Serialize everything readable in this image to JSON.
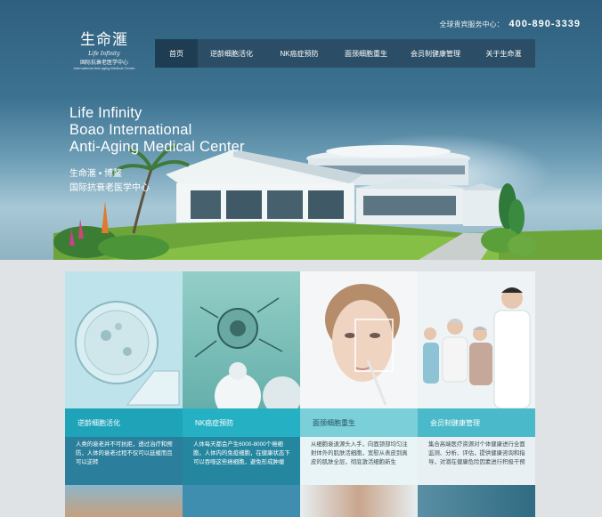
{
  "brand": {
    "logo_cn": "生命滙",
    "logo_en": "Life Infinity",
    "logo_sub": "国际抗衰老医学中心",
    "logo_sub_en": "International Anti-aging Medical Centre"
  },
  "hotline": {
    "label": "全球贵宾服务中心：",
    "number": "400-890-3339"
  },
  "nav": {
    "items": [
      {
        "label": "首页",
        "active": true
      },
      {
        "label": "逆龄细胞活化"
      },
      {
        "label": "NK癌症预防"
      },
      {
        "label": "面颈细胞重生"
      },
      {
        "label": "会员制健康管理"
      },
      {
        "label": "关于生命滙"
      }
    ]
  },
  "hero": {
    "line1": "Life Infinity",
    "line2": "Boao International",
    "line3": "Anti-Aging Medical Center",
    "cn1": "生命滙 • 博鳌",
    "cn2": "国际抗衰老医学中心"
  },
  "cards": [
    {
      "title": "逆龄细胞活化",
      "text": "人类的衰老并不可抗拒，透过治疗和预防，人体的衰老过程不仅可以延缓而且可以逆转",
      "icon": "cell-image"
    },
    {
      "title": "NK癌症预防",
      "text": "人体每天都会产生6000-8000个癌细胞，人体内的免疫细胞，在健康状态下可以吞噬这些癌细胞，避免形成肿瘤",
      "icon": "lab-image"
    },
    {
      "title": "面颈细胞重生",
      "text": "从细胞衰退源头入手，向面颈部均匀注射体外的肌肤活细胞，宽慰从表皮到真皮的肌肤全层，彻底激活细胞新生",
      "icon": "face-image"
    },
    {
      "title": "会员制健康管理",
      "text": "集合高端医疗资源对个体健康进行全面监测、分析、评估，提供健康咨询和指导，对潜在健康危险因素进行积极干预",
      "icon": "doctor-image"
    }
  ],
  "colors": {
    "nav_bg": "#2b4e66",
    "accent": "#1fa3b9"
  }
}
